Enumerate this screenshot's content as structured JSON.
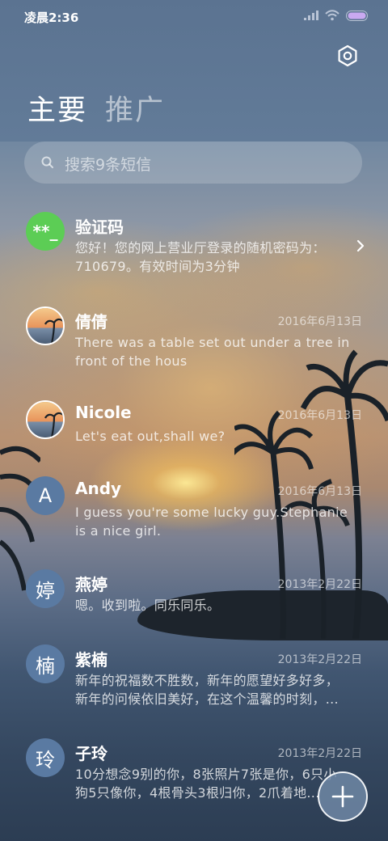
{
  "status_bar": {
    "time": "凌晨2:36",
    "icons": [
      "signal-icon",
      "wifi-icon",
      "battery-icon"
    ]
  },
  "header": {
    "settings_icon": "gear-icon",
    "tabs": [
      {
        "label": "主要",
        "active": true
      },
      {
        "label": "推广",
        "active": false
      }
    ]
  },
  "search": {
    "placeholder": "搜索9条短信",
    "icon": "search-icon"
  },
  "threads": [
    {
      "name": "验证码",
      "date": "",
      "avatar": "**_",
      "avatar_type": "badge",
      "preview_line1": "您好！您的网上营业厅登录的随机密码为：",
      "preview_line2": "710679。有效时间为3分钟",
      "has_chevron": true
    },
    {
      "name": "倩倩",
      "date": "2016年6月13日",
      "avatar": "",
      "avatar_type": "photo",
      "preview_line1": "There was a table set out under a tree in",
      "preview_line2": "front of the hous"
    },
    {
      "name": "Nicole",
      "date": "2016年6月13日",
      "avatar": "",
      "avatar_type": "photo",
      "preview_line1": "Let's eat out,shall we?",
      "preview_line2": ""
    },
    {
      "name": "Andy",
      "date": "2016年6月13日",
      "avatar": "A",
      "avatar_type": "letter",
      "preview_line1": "I guess you're some lucky guy.Stephanie",
      "preview_line2": "is a nice girl."
    },
    {
      "name": "燕婷",
      "date": "2013年2月22日",
      "avatar": "婷",
      "avatar_type": "letter",
      "preview_line1": "嗯。收到啦。同乐同乐。",
      "preview_line2": ""
    },
    {
      "name": "紫楠",
      "date": "2013年2月22日",
      "avatar": "楠",
      "avatar_type": "letter",
      "preview_line1": "新年的祝福数不胜数，新年的愿望好多好多，",
      "preview_line2": "新年的问候依旧美好，在这个温馨的时刻，..."
    },
    {
      "name": "子玲",
      "date": "2013年2月22日",
      "avatar": "玲",
      "avatar_type": "letter",
      "preview_line1": "10分想念9别的你，8张照片7张是你，6只小",
      "preview_line2": "狗5只像你，4根骨头3根归你，2爪着地..."
    }
  ],
  "fab": {
    "icon": "plus-icon"
  },
  "colors": {
    "badge_green": "#5ccd55",
    "letter_avatar": "#5a7aa2"
  }
}
